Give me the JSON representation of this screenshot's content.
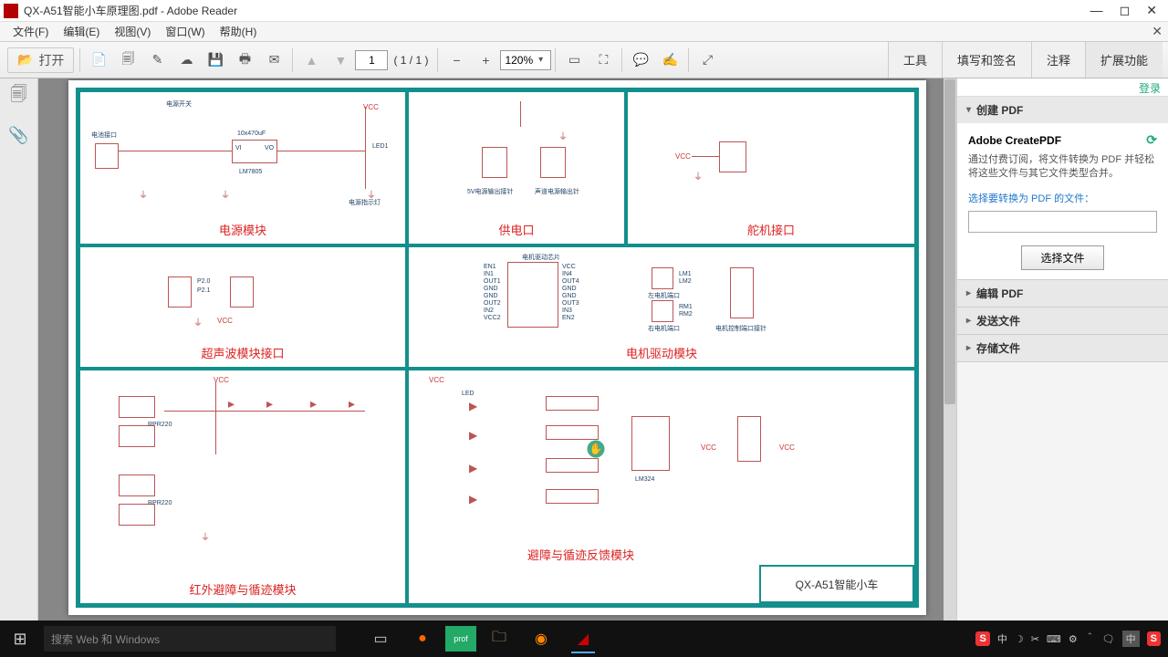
{
  "window": {
    "title": "QX-A51智能小车原理图.pdf - Adobe Reader"
  },
  "menus": [
    "文件(F)",
    "编辑(E)",
    "视图(V)",
    "窗口(W)",
    "帮助(H)"
  ],
  "toolbar": {
    "open_label": "打开",
    "page_current": "1",
    "page_count": "( 1 / 1 )",
    "zoom_value": "120%",
    "tabs": {
      "tools": "工具",
      "sign": "填写和签名",
      "comment": "注释",
      "extend": "扩展功能"
    }
  },
  "right_panel": {
    "login": "登录",
    "create_header": "创建 PDF",
    "create_title": "Adobe CreatePDF",
    "create_desc": "通过付费订阅，将文件转换为 PDF 并轻松将这些文件与其它文件类型合并。",
    "select_label": "选择要转换为 PDF 的文件：",
    "select_button": "选择文件",
    "edit_header": "编辑 PDF",
    "send_header": "发送文件",
    "store_header": "存储文件"
  },
  "schematic": {
    "cells": {
      "power": "电源模块",
      "supply": "供电口",
      "servo": "舵机接口",
      "ultra": "超声波模块接口",
      "motor": "电机驱动模块",
      "ir": "红外避障与循迹模块",
      "obst": "避障与循迹反馈模块"
    },
    "legend": "QX-A51智能小车",
    "power": {
      "sw_label": "电源开关",
      "reg": "LM7805",
      "vin": "VI",
      "vout": "VO",
      "cap": "10x470uF",
      "led": "LED1",
      "vcc": "VCC",
      "conn": "电池接口",
      "ind": "电源指示灯"
    },
    "supply": {
      "note5v": "5V电源输出接针",
      "noteRaw": "声道电源输出针"
    },
    "servo": {
      "vcc": "VCC"
    },
    "ultra": {
      "vcc": "VCC",
      "p20": "P2.0",
      "p21": "P2.1"
    },
    "motor": {
      "chip_label": "电机驱动芯片",
      "en1": "EN1",
      "in1": "IN1",
      "out1": "OUT1",
      "in2": "IN2",
      "out2": "OUT2",
      "gnd": "GND",
      "vcc": "VCC",
      "vcc2": "VCC2",
      "en2": "EN2",
      "in3": "IN3",
      "out3": "OUT3",
      "in4": "IN4",
      "out4": "OUT4",
      "leftH": "左电机端口",
      "rightH": "右电机端口",
      "ctrlH": "电机控制端口接针",
      "lm1": "LM1",
      "lm2": "LM2",
      "rm1": "RM1",
      "rm2": "RM2"
    },
    "ir": {
      "chip": "RPR220",
      "vcc": "VCC"
    },
    "obst": {
      "opamp": "LM324",
      "vcc": "VCC",
      "led": "LED"
    }
  },
  "taskbar": {
    "search_placeholder": "搜索 Web 和 Windows",
    "tray": {
      "ime_s": "S",
      "cn": "中",
      "ime2": "中"
    }
  }
}
